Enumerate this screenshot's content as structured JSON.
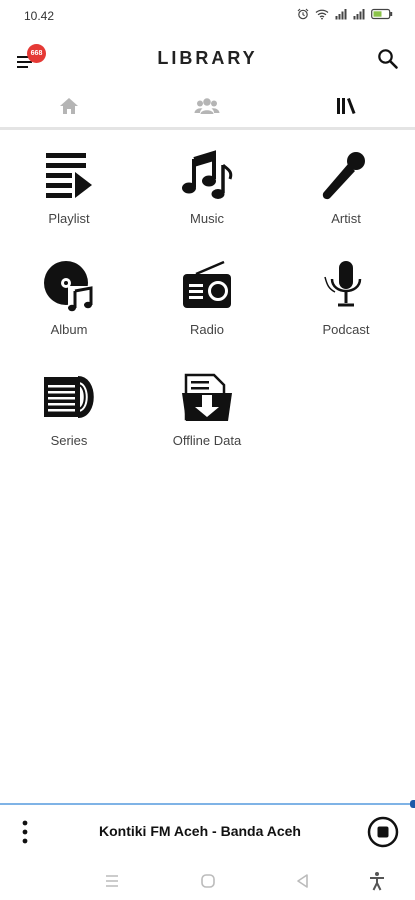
{
  "status_bar": {
    "time": "10.42",
    "icons": [
      "alarm-icon",
      "wifi-icon",
      "signal-icon",
      "signal-icon",
      "battery-icon"
    ]
  },
  "app_bar": {
    "title": "LIBRARY",
    "menu_icon": "menu-icon",
    "notification_badge": "668",
    "search_icon": "search-icon"
  },
  "tabs": [
    {
      "icon": "home-icon",
      "active": false
    },
    {
      "icon": "people-icon",
      "active": false
    },
    {
      "icon": "library-icon",
      "active": true
    }
  ],
  "library_items": [
    {
      "label": "Playlist",
      "icon": "playlist-icon"
    },
    {
      "label": "Music",
      "icon": "music-notes-icon"
    },
    {
      "label": "Artist",
      "icon": "microphone-icon"
    },
    {
      "label": "Album",
      "icon": "album-disc-icon"
    },
    {
      "label": "Radio",
      "icon": "radio-icon"
    },
    {
      "label": "Podcast",
      "icon": "podcast-mic-icon"
    },
    {
      "label": "Series",
      "icon": "series-icon"
    },
    {
      "label": "Offline Data",
      "icon": "offline-download-icon"
    }
  ],
  "player": {
    "station": "Kontiki FM Aceh - Banda Aceh",
    "more_icon": "more-vertical-icon",
    "stop_icon": "stop-icon"
  },
  "system_nav": [
    "recent-apps-icon",
    "home-circle-icon",
    "back-icon",
    "accessibility-icon"
  ],
  "colors": {
    "badge": "#e53935",
    "progress_line": "#7fb3e6",
    "progress_dot": "#1e5aa8",
    "icon": "#111111",
    "inactive_tab": "#b5b5b5"
  }
}
